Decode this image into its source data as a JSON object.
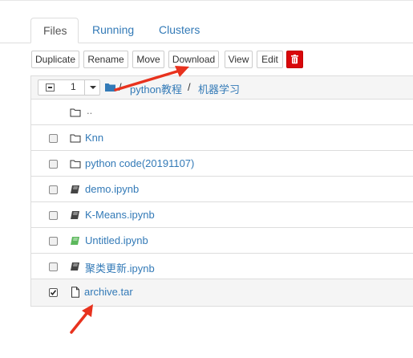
{
  "tabs": [
    {
      "label": "Files",
      "active": true
    },
    {
      "label": "Running",
      "active": false
    },
    {
      "label": "Clusters",
      "active": false
    }
  ],
  "toolbar": {
    "duplicate": "Duplicate",
    "rename": "Rename",
    "move": "Move",
    "download": "Download",
    "view": "View",
    "edit": "Edit",
    "delete_icon": "trash-icon"
  },
  "selection": {
    "count": "1"
  },
  "breadcrumb": {
    "root_icon": "folder-icon",
    "separator": "/",
    "items": [
      "python教程",
      "机器学习"
    ]
  },
  "files": [
    {
      "name": "..",
      "icon": "folder-icon",
      "checked": false
    },
    {
      "name": "Knn",
      "icon": "folder-icon",
      "checked": false
    },
    {
      "name": "python code(20191107)",
      "icon": "folder-icon",
      "checked": false
    },
    {
      "name": "demo.ipynb",
      "icon": "notebook-icon",
      "checked": false
    },
    {
      "name": "K-Means.ipynb",
      "icon": "notebook-icon",
      "checked": false
    },
    {
      "name": "Untitled.ipynb",
      "icon": "notebook-running-icon",
      "checked": false
    },
    {
      "name": "聚类更新.ipynb",
      "icon": "notebook-icon",
      "checked": false
    },
    {
      "name": "archive.tar",
      "icon": "file-icon",
      "checked": true
    }
  ],
  "colors": {
    "link": "#337ab7",
    "danger": "#d9070a",
    "running_notebook": "#5cb85c",
    "annotation_arrow": "#e8321e"
  }
}
